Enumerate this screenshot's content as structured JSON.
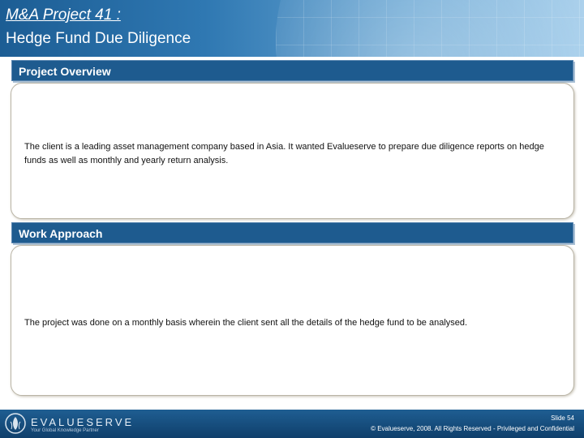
{
  "header": {
    "title_line1": "M&A Project 41 :",
    "title_line2": "Hedge Fund Due Diligence"
  },
  "sections": [
    {
      "heading": "Project  Overview",
      "body": "The client is a leading asset management company based in Asia. It wanted Evalueserve to prepare due diligence reports on hedge funds as well as monthly and yearly return analysis."
    },
    {
      "heading": "Work Approach",
      "body": "The project was done on a monthly basis wherein the client sent all the details of the hedge fund to be analysed."
    }
  ],
  "footer": {
    "brand": "EVALUESERVE",
    "tagline": "Your Global Knowledge Partner",
    "slide_number": "Slide 54",
    "copyright": "© Evalueserve, 2008. All Rights Reserved - Privileged and Confidential"
  },
  "colors": {
    "header_blue": "#1c5d94",
    "section_bar": "#1e5b8f",
    "footer_blue": "#0f3f6b"
  }
}
